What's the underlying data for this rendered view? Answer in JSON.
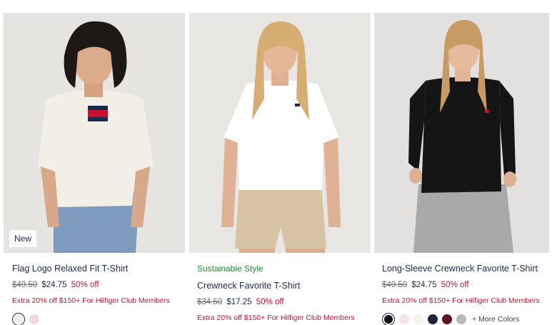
{
  "products": [
    {
      "badge": "New",
      "tag": "",
      "title": "Flag Logo Relaxed Fit T-Shirt",
      "original_price": "$49.50",
      "sale_price": "$24.75",
      "discount": "50% off",
      "promo": "Extra 20% off $150+ For Hilfiger Club Members",
      "swatches": [
        "#f1ece4",
        "#f2d9de"
      ],
      "more_colors": ""
    },
    {
      "badge": "",
      "tag": "Sustainable Style",
      "title": "Crewneck Favorite T-Shirt",
      "original_price": "$34.50",
      "sale_price": "$17.25",
      "discount": "50% off",
      "promo": "Extra 20% off $150+ For Hilfiger Club Members",
      "swatches": [],
      "more_colors": ""
    },
    {
      "badge": "",
      "tag": "",
      "title": "Long-Sleeve Crewneck Favorite T-Shirt",
      "original_price": "$49.50",
      "sale_price": "$24.75",
      "discount": "50% off",
      "promo": "Extra 20% off $150+ For Hilfiger Club Members",
      "swatches": [
        "#111111",
        "#f4e6e8",
        "#f4f1ea",
        "#1c2440",
        "#5c1424",
        "#b9b9b9"
      ],
      "more_colors": "+ More Colors"
    }
  ],
  "colors": {
    "promo": "#c8102e",
    "sustainable": "#1e8b2e",
    "navy": "#1b2a4a"
  }
}
